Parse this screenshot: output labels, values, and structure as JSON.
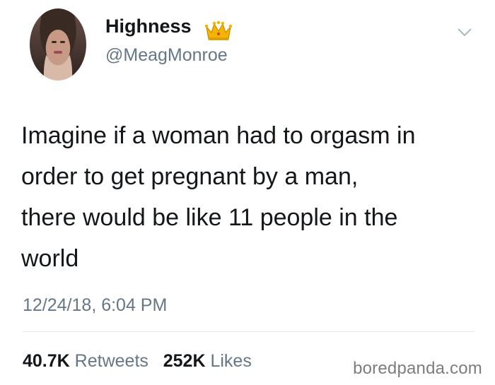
{
  "user": {
    "display_name": "Highness",
    "handle": "@MeagMonroe",
    "badge_icon": "crown-icon"
  },
  "tweet": {
    "text": "Imagine if a woman had to orgasm in\norder to get pregnant by a man,\nthere would be like 11 people in the\nworld",
    "timestamp": "12/24/18, 6:04 PM"
  },
  "stats": {
    "retweets_count": "40.7K",
    "retweets_label": "Retweets",
    "likes_count": "252K",
    "likes_label": "Likes"
  },
  "watermark": "boredpanda.com",
  "colors": {
    "text": "#14171a",
    "secondary": "#657786",
    "divider": "#e1e8ed",
    "crown": "#f4b400"
  }
}
